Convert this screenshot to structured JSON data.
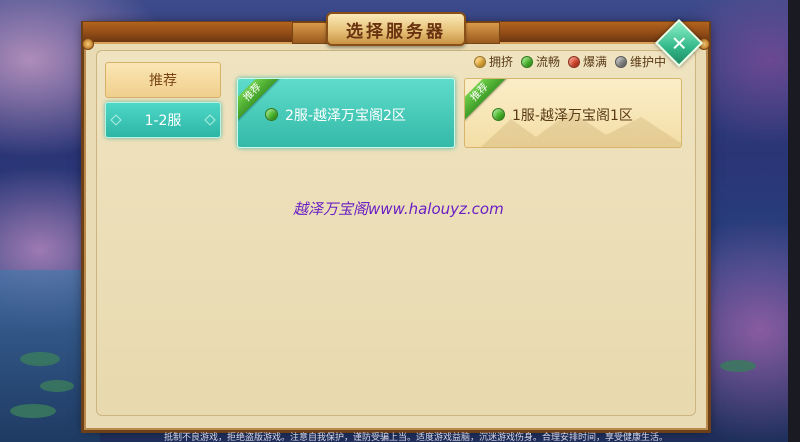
{
  "title": "选择服务器",
  "close_icon": "close-icon",
  "legend": [
    {
      "label": "拥挤",
      "color": "#f2b43a"
    },
    {
      "label": "流畅",
      "color": "#4bbf2a"
    },
    {
      "label": "爆满",
      "color": "#e0482c"
    },
    {
      "label": "维护中",
      "color": "#8a8a8a"
    }
  ],
  "tabs": [
    {
      "label": "推荐"
    },
    {
      "label": "1-2服"
    }
  ],
  "servers": [
    {
      "name": "2服-越泽万宝阁2区",
      "badge": "推荐",
      "status_color": "#4bbf2a",
      "selected": true
    },
    {
      "name": "1服-越泽万宝阁1区",
      "badge": "推荐",
      "status_color": "#4bbf2a",
      "selected": false
    }
  ],
  "watermark": "越泽万宝阁www.halouyz.com",
  "footer": "抵制不良游戏，拒绝盗版游戏。注意自我保护，谨防受骗上当。适度游戏益脑，沉迷游戏伤身。合理安排时间，享受健康生活。"
}
